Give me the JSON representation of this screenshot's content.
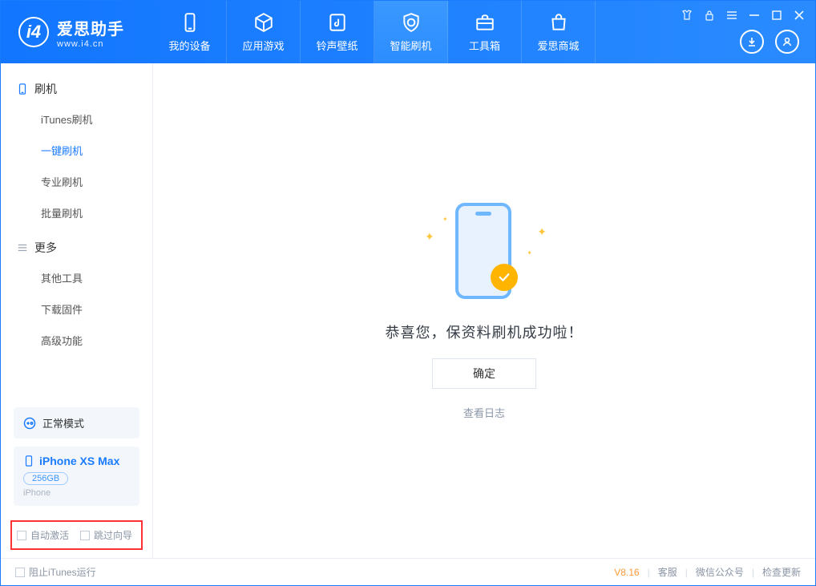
{
  "app": {
    "title": "爱思助手",
    "site": "www.i4.cn"
  },
  "nav": [
    {
      "label": "我的设备",
      "icon": "device-icon"
    },
    {
      "label": "应用游戏",
      "icon": "cube-icon"
    },
    {
      "label": "铃声壁纸",
      "icon": "music-icon"
    },
    {
      "label": "智能刷机",
      "icon": "shield-icon",
      "active": true
    },
    {
      "label": "工具箱",
      "icon": "toolbox-icon"
    },
    {
      "label": "爱思商城",
      "icon": "bag-icon"
    }
  ],
  "sidebar": {
    "group1": {
      "title": "刷机",
      "items": [
        "iTunes刷机",
        "一键刷机",
        "专业刷机",
        "批量刷机"
      ],
      "activeIndex": 1
    },
    "group2": {
      "title": "更多",
      "items": [
        "其他工具",
        "下载固件",
        "高级功能"
      ]
    },
    "mode": "正常模式",
    "device": {
      "name": "iPhone XS Max",
      "capacity": "256GB",
      "type": "iPhone"
    },
    "options": {
      "autoActivate": "自动激活",
      "skipGuide": "跳过向导"
    }
  },
  "main": {
    "message": "恭喜您，保资料刷机成功啦！",
    "okButton": "确定",
    "logLink": "查看日志"
  },
  "statusbar": {
    "blockItunes": "阻止iTunes运行",
    "version": "V8.16",
    "links": [
      "客服",
      "微信公众号",
      "检查更新"
    ]
  }
}
